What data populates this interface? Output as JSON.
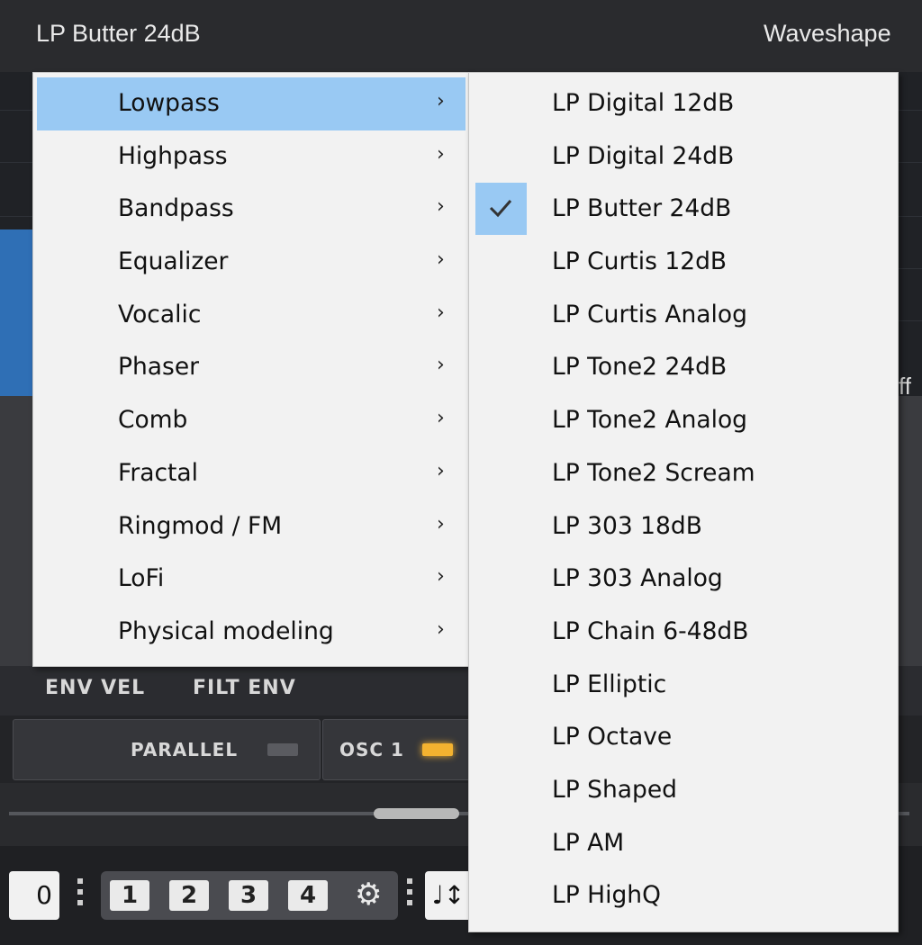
{
  "header": {
    "current_filter": "LP Butter 24dB",
    "waveshape_label": "Waveshape"
  },
  "side_labels": {
    "off_fragment": "ff"
  },
  "env_row": {
    "env_vel": "ENV VEL",
    "filt_env": "FILT ENV"
  },
  "routing": {
    "parallel_label": "PARALLEL",
    "osc1_label": "OSC 1",
    "parallel_led_color": "#5a5b60",
    "osc1_led_color": "#f3b230"
  },
  "bottom_bar": {
    "value": "0",
    "slots": [
      "1",
      "2",
      "3",
      "4"
    ],
    "gear": "⚙",
    "note_icon": "♩↕"
  },
  "menu_main": {
    "arrow": "›",
    "items": [
      {
        "label": "Lowpass",
        "active": true
      },
      {
        "label": "Highpass"
      },
      {
        "label": "Bandpass"
      },
      {
        "label": "Equalizer"
      },
      {
        "label": "Vocalic"
      },
      {
        "label": "Phaser"
      },
      {
        "label": "Comb"
      },
      {
        "label": "Fractal"
      },
      {
        "label": "Ringmod / FM"
      },
      {
        "label": "LoFi"
      },
      {
        "label": "Physical modeling"
      }
    ]
  },
  "menu_sub": {
    "items": [
      {
        "label": "LP Digital 12dB"
      },
      {
        "label": "LP Digital 24dB"
      },
      {
        "label": "LP Butter 24dB",
        "checked": true
      },
      {
        "label": "LP Curtis 12dB"
      },
      {
        "label": "LP Curtis Analog"
      },
      {
        "label": "LP Tone2 24dB"
      },
      {
        "label": "LP Tone2 Analog"
      },
      {
        "label": "LP Tone2 Scream"
      },
      {
        "label": "LP 303 18dB"
      },
      {
        "label": "LP 303 Analog"
      },
      {
        "label": "LP Chain 6-48dB"
      },
      {
        "label": "LP Elliptic"
      },
      {
        "label": "LP Octave"
      },
      {
        "label": "LP Shaped"
      },
      {
        "label": "LP AM"
      },
      {
        "label": "LP HighQ"
      }
    ]
  },
  "colors": {
    "menu_bg": "#f2f2f2",
    "highlight": "#99c9f3"
  }
}
